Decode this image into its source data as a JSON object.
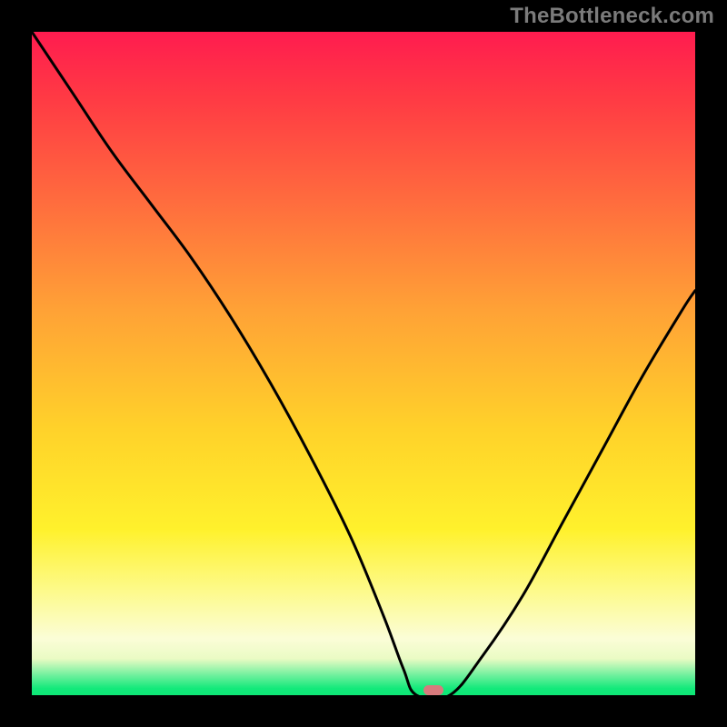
{
  "watermark": "TheBottleneck.com",
  "colors": {
    "frame": "#000000",
    "curve": "#000000",
    "marker": "#d87a7d",
    "watermark": "#7b7b7b"
  },
  "chart_data": {
    "type": "line",
    "title": "",
    "xlabel": "",
    "ylabel": "",
    "xlim": [
      0,
      100
    ],
    "ylim": [
      0,
      100
    ],
    "grid": false,
    "series": [
      {
        "name": "bottleneck-curve",
        "x": [
          0,
          6,
          12,
          18,
          24,
          30,
          36,
          42,
          48,
          53,
          56,
          58,
          63,
          68,
          74,
          80,
          86,
          92,
          98,
          100
        ],
        "values": [
          100,
          91,
          82,
          74,
          66,
          57,
          47,
          36,
          24,
          12,
          4,
          0,
          0,
          6,
          15,
          26,
          37,
          48,
          58,
          61
        ]
      }
    ],
    "marker": {
      "x": 60.5,
      "y": 0,
      "width_pct": 3.0,
      "height_pct": 1.5
    },
    "legend": false
  }
}
